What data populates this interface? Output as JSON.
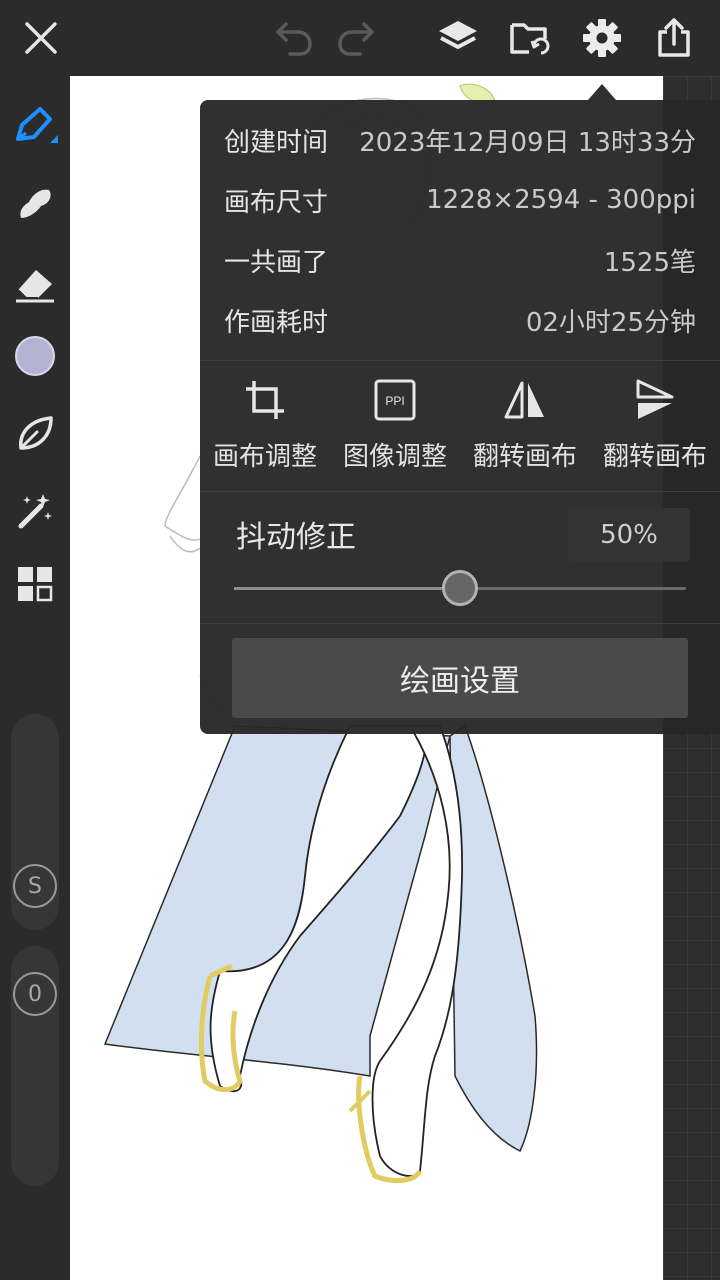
{
  "topbar": {
    "close_icon": "close-icon",
    "undo_icon": "undo-icon",
    "redo_icon": "redo-icon",
    "layers_icon": "layers-icon",
    "folder_icon": "folder-refresh-icon",
    "settings_icon": "gear-icon",
    "share_icon": "share-icon"
  },
  "leftbar": {
    "tools": [
      "pen-icon",
      "smudge-icon",
      "eraser-icon",
      "color-swatch",
      "leaf-icon",
      "magic-wand-icon",
      "grid-icon"
    ],
    "color_swatch": "#b4b4d2",
    "accent": "#1e8fff",
    "size_button": "S",
    "opacity_button": "0"
  },
  "popover": {
    "info": [
      {
        "label": "创建时间",
        "value": "2023年12月09日 13时33分"
      },
      {
        "label": "画布尺寸",
        "value": "1228×2594 - 300ppi"
      },
      {
        "label": "一共画了",
        "value": "1525笔"
      },
      {
        "label": "作画耗时",
        "value": "02小时25分钟"
      }
    ],
    "actions": [
      {
        "label": "画布调整",
        "icon": "crop-icon"
      },
      {
        "label": "图像调整",
        "icon": "ppi-icon"
      },
      {
        "label": "翻转画布",
        "icon": "flip-horizontal-icon"
      },
      {
        "label": "翻转画布",
        "icon": "flip-vertical-icon"
      }
    ],
    "stabilizer": {
      "label": "抖动修正",
      "value_text": "50%",
      "value": 0.5
    },
    "settings_button": "绘画设置",
    "ppi_badge": "PPI"
  }
}
